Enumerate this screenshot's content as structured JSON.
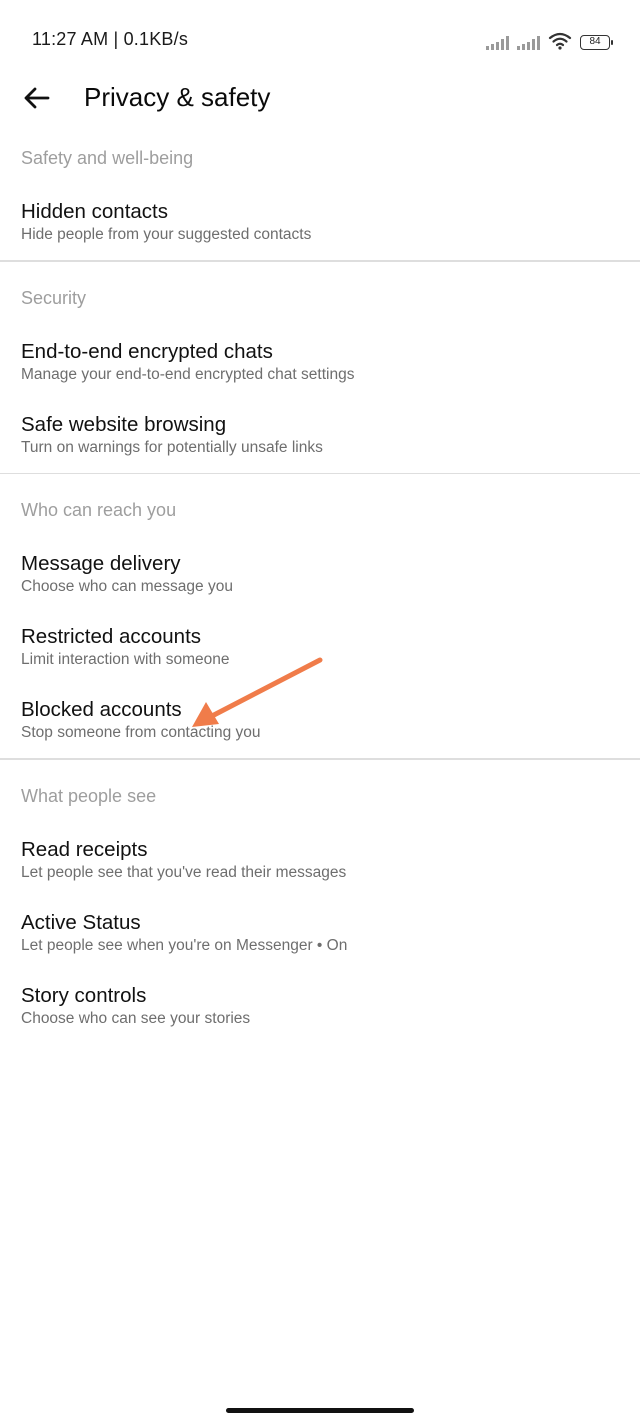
{
  "status_bar": {
    "time": "11:27 AM | 0.1KB/s",
    "battery": "84"
  },
  "header": {
    "title": "Privacy & safety",
    "back_icon": "arrow-left-icon"
  },
  "sections": [
    {
      "title": "Safety and well-being",
      "items": [
        {
          "title": "Hidden contacts",
          "subtitle": "Hide people from your suggested contacts"
        }
      ]
    },
    {
      "title": "Security",
      "items": [
        {
          "title": "End-to-end encrypted chats",
          "subtitle": "Manage your end-to-end encrypted chat settings"
        },
        {
          "title": "Safe website browsing",
          "subtitle": "Turn on warnings for potentially unsafe links"
        }
      ]
    },
    {
      "title": "Who can reach you",
      "items": [
        {
          "title": "Message delivery",
          "subtitle": "Choose who can message you"
        },
        {
          "title": "Restricted accounts",
          "subtitle": "Limit interaction with someone"
        },
        {
          "title": "Blocked accounts",
          "subtitle": "Stop someone from contacting you"
        }
      ]
    },
    {
      "title": "What people see",
      "items": [
        {
          "title": "Read receipts",
          "subtitle": "Let people see that you've read their messages"
        },
        {
          "title": "Active Status",
          "subtitle": "Let people see when you're on Messenger • On"
        },
        {
          "title": "Story controls",
          "subtitle": "Choose who can see your stories"
        }
      ]
    }
  ],
  "annotation": {
    "arrow_color": "#F07C4A"
  }
}
